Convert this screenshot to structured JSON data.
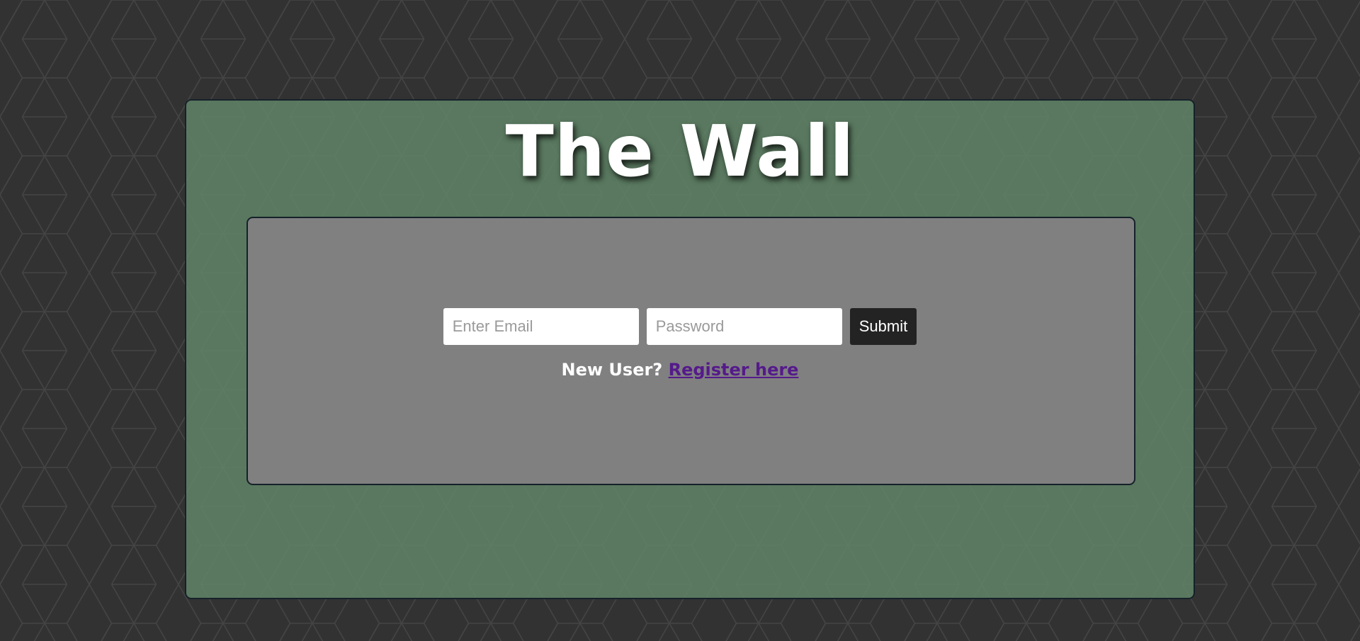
{
  "page": {
    "title": "The Wall"
  },
  "login": {
    "email_placeholder": "Enter Email",
    "email_value": "",
    "password_placeholder": "Password",
    "password_value": "",
    "submit_label": "Submit"
  },
  "register": {
    "prompt": "New User?",
    "link_label": "Register here"
  },
  "colors": {
    "background": "#323232",
    "panel": "#577560",
    "login_box": "#808080",
    "border": "#16212a",
    "submit": "#232323",
    "link": "#551a8b"
  },
  "icons": {
    "background_pattern": "hexagon-pattern"
  }
}
